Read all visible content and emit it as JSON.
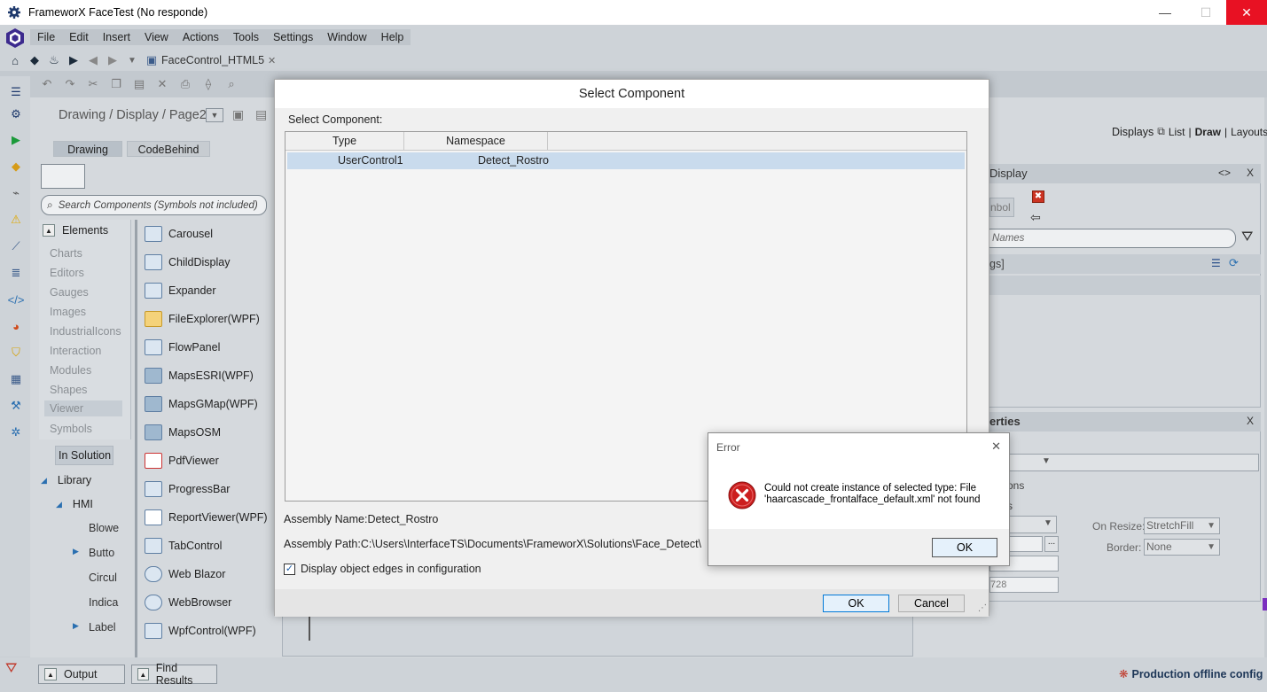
{
  "window": {
    "title": "FrameworX FaceTest (No responde)",
    "minimize": "—",
    "maximize": "☐",
    "close": "✕"
  },
  "menu": [
    "File",
    "Edit",
    "Insert",
    "View",
    "Actions",
    "Tools",
    "Settings",
    "Window",
    "Help"
  ],
  "toolbar": {
    "doc_tab": "FaceControl_HTML5",
    "doc_tab_close": "✕"
  },
  "editor": {
    "breadcrumb": "Drawing / Display / Page2",
    "tabs": [
      "Drawing",
      "CodeBehind"
    ],
    "search_placeholder": "Search Components (Symbols not included)"
  },
  "categories": {
    "header": "Elements",
    "items": [
      "Charts",
      "Editors",
      "Gauges",
      "Images",
      "IndustrialIcons",
      "Interaction",
      "Modules",
      "Shapes",
      "Viewer",
      "Symbols"
    ],
    "in_solution": "In Solution",
    "library": "Library",
    "hmi": "HMI",
    "hmi_items": [
      "Blowe",
      "Butto",
      "Circul",
      "Indica",
      "Label"
    ]
  },
  "components": [
    "Carousel",
    "ChildDisplay",
    "Expander",
    "FileExplorer(WPF)",
    "FlowPanel",
    "MapsESRI(WPF)",
    "MapsGMap(WPF)",
    "MapsOSM",
    "PdfViewer",
    "ProgressBar",
    "ReportViewer(WPF)",
    "TabControl",
    "Web Blazor",
    "WebBrowser",
    "WpfControl(WPF)"
  ],
  "right_panel": {
    "displays": "Displays",
    "list": "List",
    "sep": "|",
    "draw": "Draw",
    "layouts": "Layouts",
    "panel1_title": "Display",
    "panel1_tag": "<>",
    "panel1_close": "X",
    "symbol_btn": "nbol",
    "names_placeholder": "Names",
    "tags_row": "gs]",
    "panel2_title": "erties",
    "panel2_close": "X",
    "ons": "ons",
    "s": "s",
    "on_resize_label": "On Resize:",
    "on_resize_value": "StretchFill",
    "border_label": "Border:",
    "border_value": "None",
    "field_dots": "...",
    "field_1": "",
    "field_3": "728"
  },
  "dialog": {
    "title": "Select Component",
    "label": "Select Component:",
    "columns": [
      "Type",
      "Namespace"
    ],
    "rows": [
      {
        "type": "UserControl1",
        "namespace": "Detect_Rostro"
      }
    ],
    "assembly_name": "Assembly Name:Detect_Rostro",
    "assembly_path": "Assembly Path:C:\\Users\\InterfaceTS\\Documents\\FrameworX\\Solutions\\Face_Detect\\",
    "checkbox_label": "Display object edges in configuration",
    "ok": "OK",
    "cancel": "Cancel"
  },
  "error": {
    "title": "Error",
    "line1": "Could not create instance of selected type: File",
    "line2": "'haarcascade_frontalface_default.xml' not found",
    "ok": "OK",
    "close": "✕"
  },
  "bottom": {
    "output": "Output",
    "find_results": "Find Results",
    "status": "Production offline config"
  },
  "colors": {
    "close_red": "#e81123",
    "selection": "#c9dbed",
    "accent": "#0078d7",
    "error_red": "#cc1f1f"
  }
}
